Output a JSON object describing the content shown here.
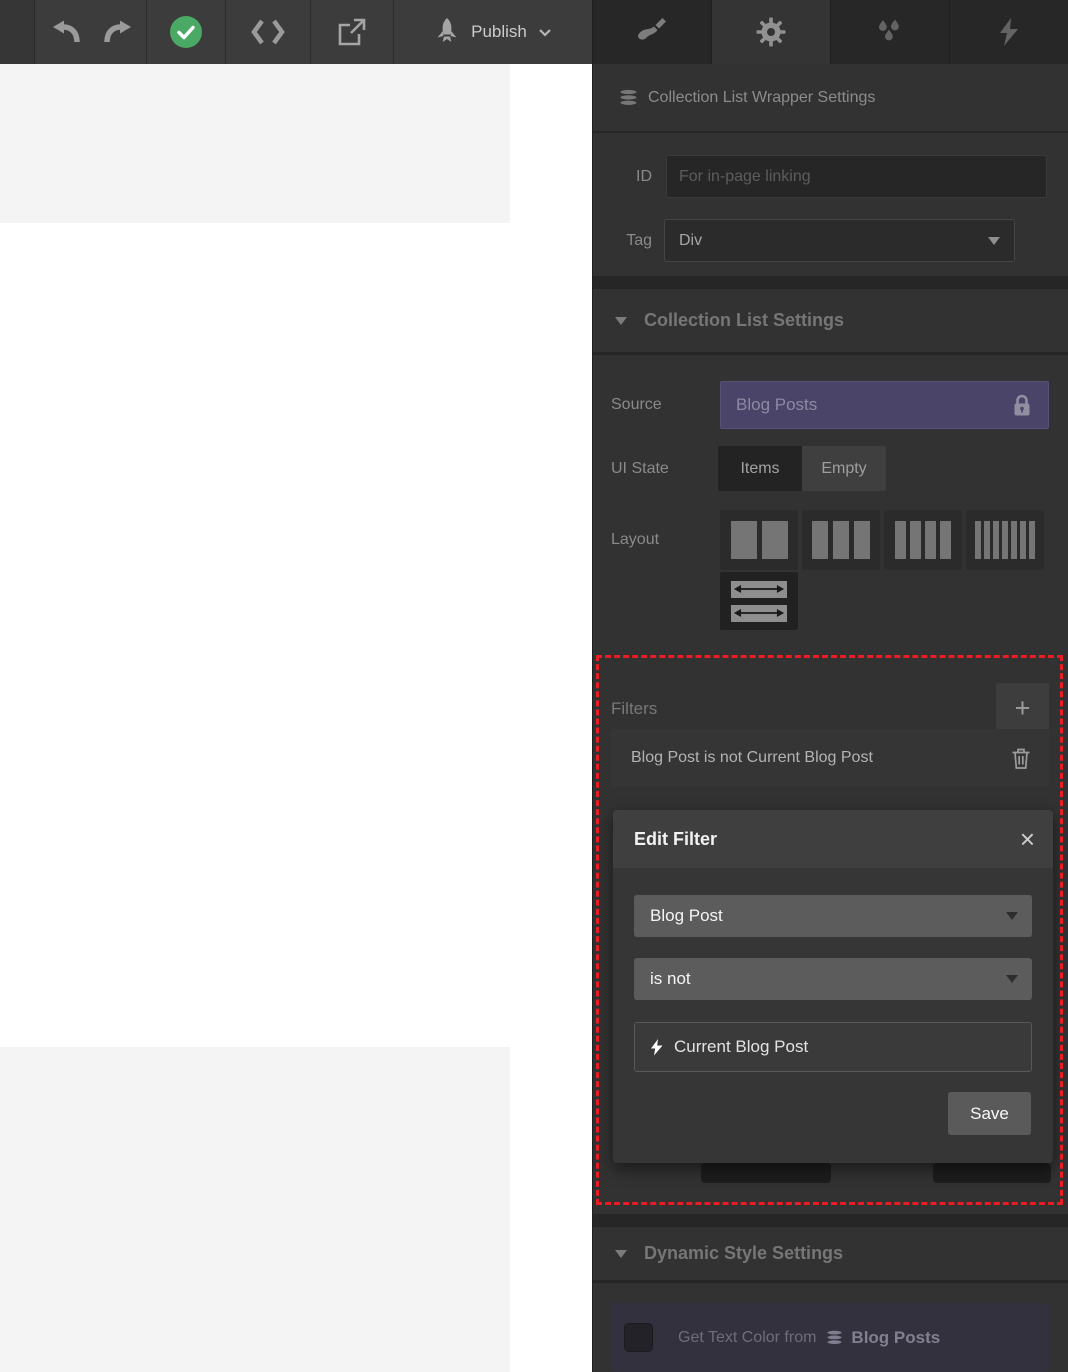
{
  "colors": {
    "accent_purple": "#4a4469",
    "annotation_red": "#ea1c24",
    "publish_green": "#4aa964"
  },
  "toolbar": {
    "publish_label": "Publish"
  },
  "panel": {
    "title": "Collection List Wrapper Settings",
    "id_row": {
      "label": "ID",
      "placeholder": "For in-page linking",
      "value": ""
    },
    "tag_row": {
      "label": "Tag",
      "value": "Div"
    },
    "sections": {
      "collection_list": {
        "title": "Collection List Settings",
        "source_row": {
          "label": "Source",
          "value": "Blog Posts",
          "locked": true
        },
        "ui_state_row": {
          "label": "UI State",
          "options": [
            "Items",
            "Empty"
          ],
          "selected": "Items"
        },
        "layout_row": {
          "label": "Layout"
        },
        "filters": {
          "label": "Filters",
          "add_glyph": "+",
          "rows": [
            {
              "text": "Blog Post is not Current Blog Post"
            }
          ]
        }
      },
      "dynamic_style": {
        "title": "Dynamic Style Settings",
        "get_text_color": {
          "label": "Get Text Color from",
          "source": "Blog Posts",
          "checked": false
        }
      }
    },
    "edit_filter_modal": {
      "title": "Edit Filter",
      "close_glyph": "×",
      "field_value": "Blog Post",
      "operator_value": "is not",
      "target_value": "Current Blog Post",
      "save_label": "Save"
    }
  }
}
